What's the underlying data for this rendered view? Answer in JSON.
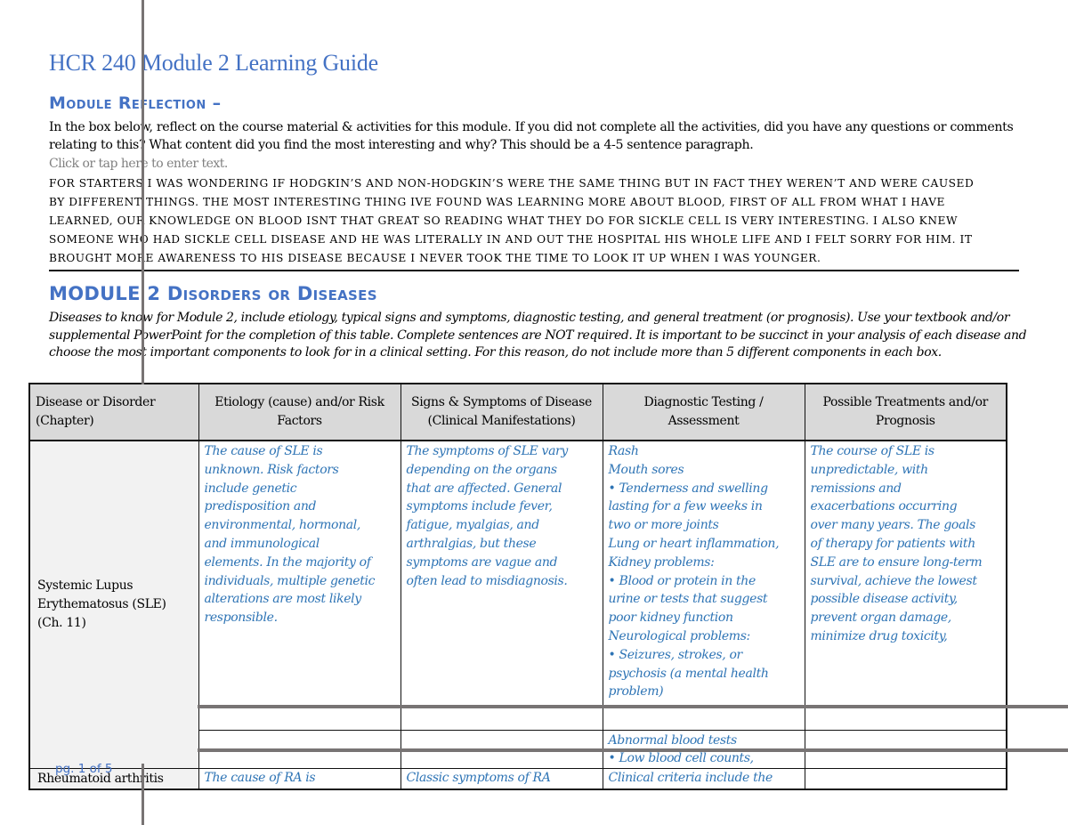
{
  "document": {
    "title": "HCR 240 Module 2 Learning Guide",
    "page_indicator": "pg. 1 of 5"
  },
  "reflection": {
    "heading": "Module Reflection –",
    "instructions": "In the box below, reflect on the course material & activities for this module.  If you did not complete all the activities, did you have any questions or comments relating to this?  What content did you find the most interesting and why?  This should be a 4-5 sentence paragraph.",
    "placeholder": "Click or tap here to enter text.",
    "response_lines": [
      "for starters I was wondering if Hodgkin’s and non-Hodgkin’s were the same thing but in fact they weren’t and were caused",
      "by different things. The most interesting thing ive found was learning more about blood, first of all from what I have",
      "learned, our knowledge on blood isnt that great so reading what they do for sickle cell is very interesting. I also knew",
      "someone who had sickle cell disease and he was literally in and out the hospital his whole life and I felt sorry for him. It",
      "brought more awareness to his disease because I never took the time to look it up when I was younger."
    ]
  },
  "disorders": {
    "heading": "MODULE 2 Disorders or Diseases",
    "instructions": "Diseases to know for Module 2, include etiology, typical signs and symptoms, diagnostic testing, and general treatment (or prognosis).  Use your textbook and/or supplemental PowerPoint for the completion of this table.  Complete sentences are NOT required.   It is important to be succinct in your analysis of each disease and choose the most important components to look for in a clinical setting. For this reason, do not include more than 5 different components in each box.",
    "table": {
      "headers": [
        "Disease or Disorder (Chapter)",
        "Etiology (cause) and/or Risk Factors",
        "Signs & Symptoms of Disease (Clinical Manifestations)",
        "Diagnostic Testing / Assessment",
        "Possible Treatments and/or Prognosis"
      ],
      "rows": [
        {
          "disease": "Systemic Lupus Erythematosus (SLE) (Ch. 11)",
          "etiology": [
            "The cause of SLE is",
            "unknown. Risk factors",
            "include genetic",
            "predisposition and",
            "environmental, hormonal,",
            "and immunological",
            "elements. In the majority of",
            "individuals, multiple genetic",
            "alterations are most likely",
            "responsible."
          ],
          "symptoms": [
            "The symptoms of SLE vary",
            "depending on the organs",
            "that are affected. General",
            "symptoms include fever,",
            "fatigue, myalgias, and",
            "arthralgias, but these",
            "symptoms are vague and",
            "often lead to misdiagnosis."
          ],
          "diagnostics": [
            "Rash",
            "Mouth sores",
            "• Tenderness and swelling",
            "lasting for a few weeks in",
            "two or more joints",
            "Lung or heart inflammation,",
            "Kidney problems:",
            "• Blood or protein in the",
            "urine or tests that suggest",
            "poor kidney function",
            "Neurological problems:",
            "• Seizures, strokes, or",
            "psychosis (a mental health",
            "problem)"
          ],
          "diagnostics_continued": [
            "Abnormal blood tests",
            "• Low blood cell counts,"
          ],
          "treatment": [
            "The course of SLE is",
            "unpredictable, with",
            "remissions and",
            "exacerbations occurring",
            "over many years. The goals",
            "of therapy for patients with",
            "SLE are to ensure long-term",
            "survival, achieve the lowest",
            "possible disease activity,",
            "prevent organ damage,",
            "minimize drug toxicity,"
          ]
        },
        {
          "disease": "Rheumatoid arthritis",
          "etiology": [
            "The cause of RA is"
          ],
          "symptoms": [
            "Classic symptoms of RA"
          ],
          "diagnostics": [
            "Clinical criteria include the"
          ],
          "treatment": []
        }
      ]
    }
  },
  "colors": {
    "heading_blue": "#4472c4",
    "entry_blue": "#2e74b5",
    "header_gray": "#d9d9d9",
    "first_col_gray": "#f2f2f2",
    "placeholder_gray": "#808080"
  }
}
